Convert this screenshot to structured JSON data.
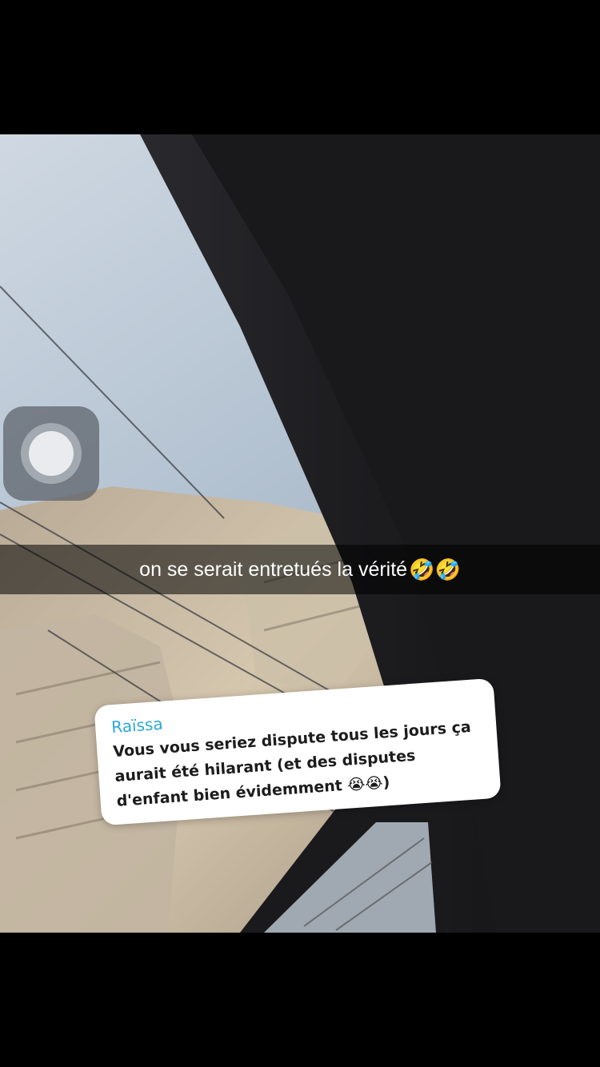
{
  "story": {
    "caption": "on se serait entretués la vérité",
    "caption_emoji": "🤣🤣",
    "reply_card": {
      "author": "Raïssa",
      "message": "Vous vous seriez dispute tous les jours ça aurait été hilarant (et des disputes d'enfant bien évidemment 😭😭)"
    }
  },
  "assistive_touch": {
    "icon": "assistive-touch-icon"
  },
  "colors": {
    "author_name": "#2aa9d6",
    "caption_bar": "rgba(0,0,0,0.55)",
    "background": "#000000"
  }
}
